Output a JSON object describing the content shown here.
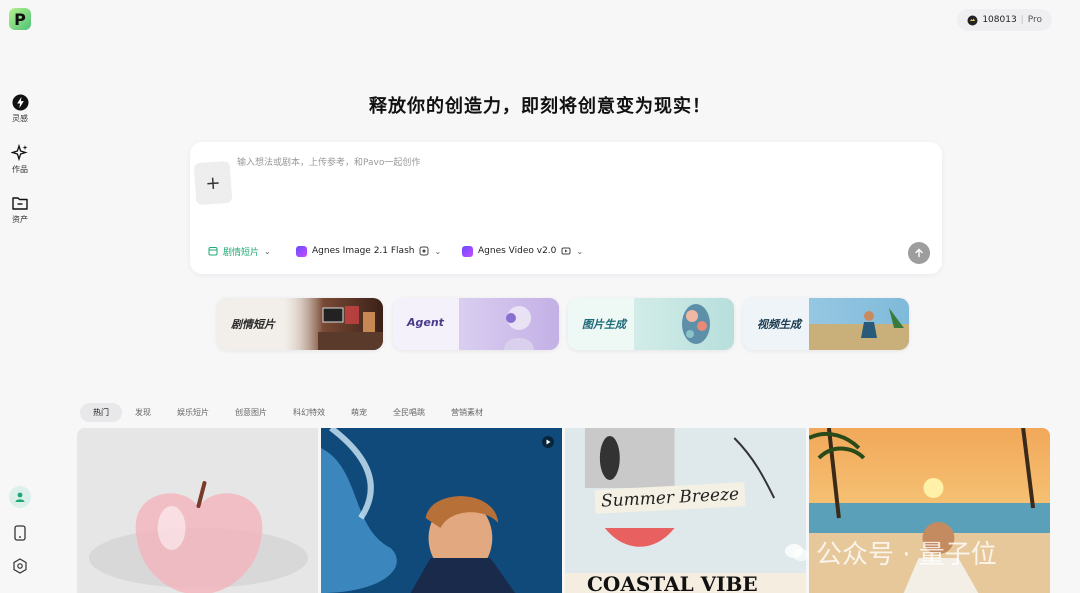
{
  "app": {
    "logo_letter": "P"
  },
  "sidebar": {
    "items": [
      {
        "label": "灵感",
        "icon": "bolt-icon"
      },
      {
        "label": "作品",
        "icon": "sparkles-icon"
      },
      {
        "label": "资产",
        "icon": "folder-icon"
      }
    ],
    "bottom_icons": [
      "user-avatar-icon",
      "phone-icon",
      "settings-hex-icon"
    ]
  },
  "header": {
    "credits": "108013",
    "plan": "Pro"
  },
  "hero": {
    "headline": "释放你的创造力，即刻将创意变为现实！"
  },
  "prompt": {
    "placeholder": "输入想法或剧本，上传参考，和Pavo一起创作",
    "add_label": "+",
    "mode_chip": "剧情短片",
    "image_model": "Agnes Image 2.1 Flash",
    "video_model": "Agnes Video v2.0"
  },
  "feature_cards": [
    {
      "label": "剧情短片",
      "color": "#2a2a2a"
    },
    {
      "label": "Agent",
      "color": "#4b3a8a"
    },
    {
      "label": "图片生成",
      "color": "#1d6a78"
    },
    {
      "label": "视频生成",
      "color": "#1a3a50"
    }
  ],
  "tabs": [
    "热门",
    "发现",
    "娱乐短片",
    "创意图片",
    "科幻特效",
    "萌宠",
    "全民唱跳",
    "营销素材"
  ],
  "active_tab": "热门",
  "gallery": [
    {
      "name": "glass-apple"
    },
    {
      "name": "water-splash-portrait"
    },
    {
      "name": "summer-breeze-collage",
      "headline": "Summer Breeze",
      "subline": "COASTAL VIBE"
    },
    {
      "name": "beach-sunset-man"
    }
  ],
  "watermark": "公众号 · 量子位",
  "colors": {
    "accent_green": "#1fa874",
    "send_button": "#9d9d9d",
    "active_tab_bg": "#e8e8ea"
  }
}
